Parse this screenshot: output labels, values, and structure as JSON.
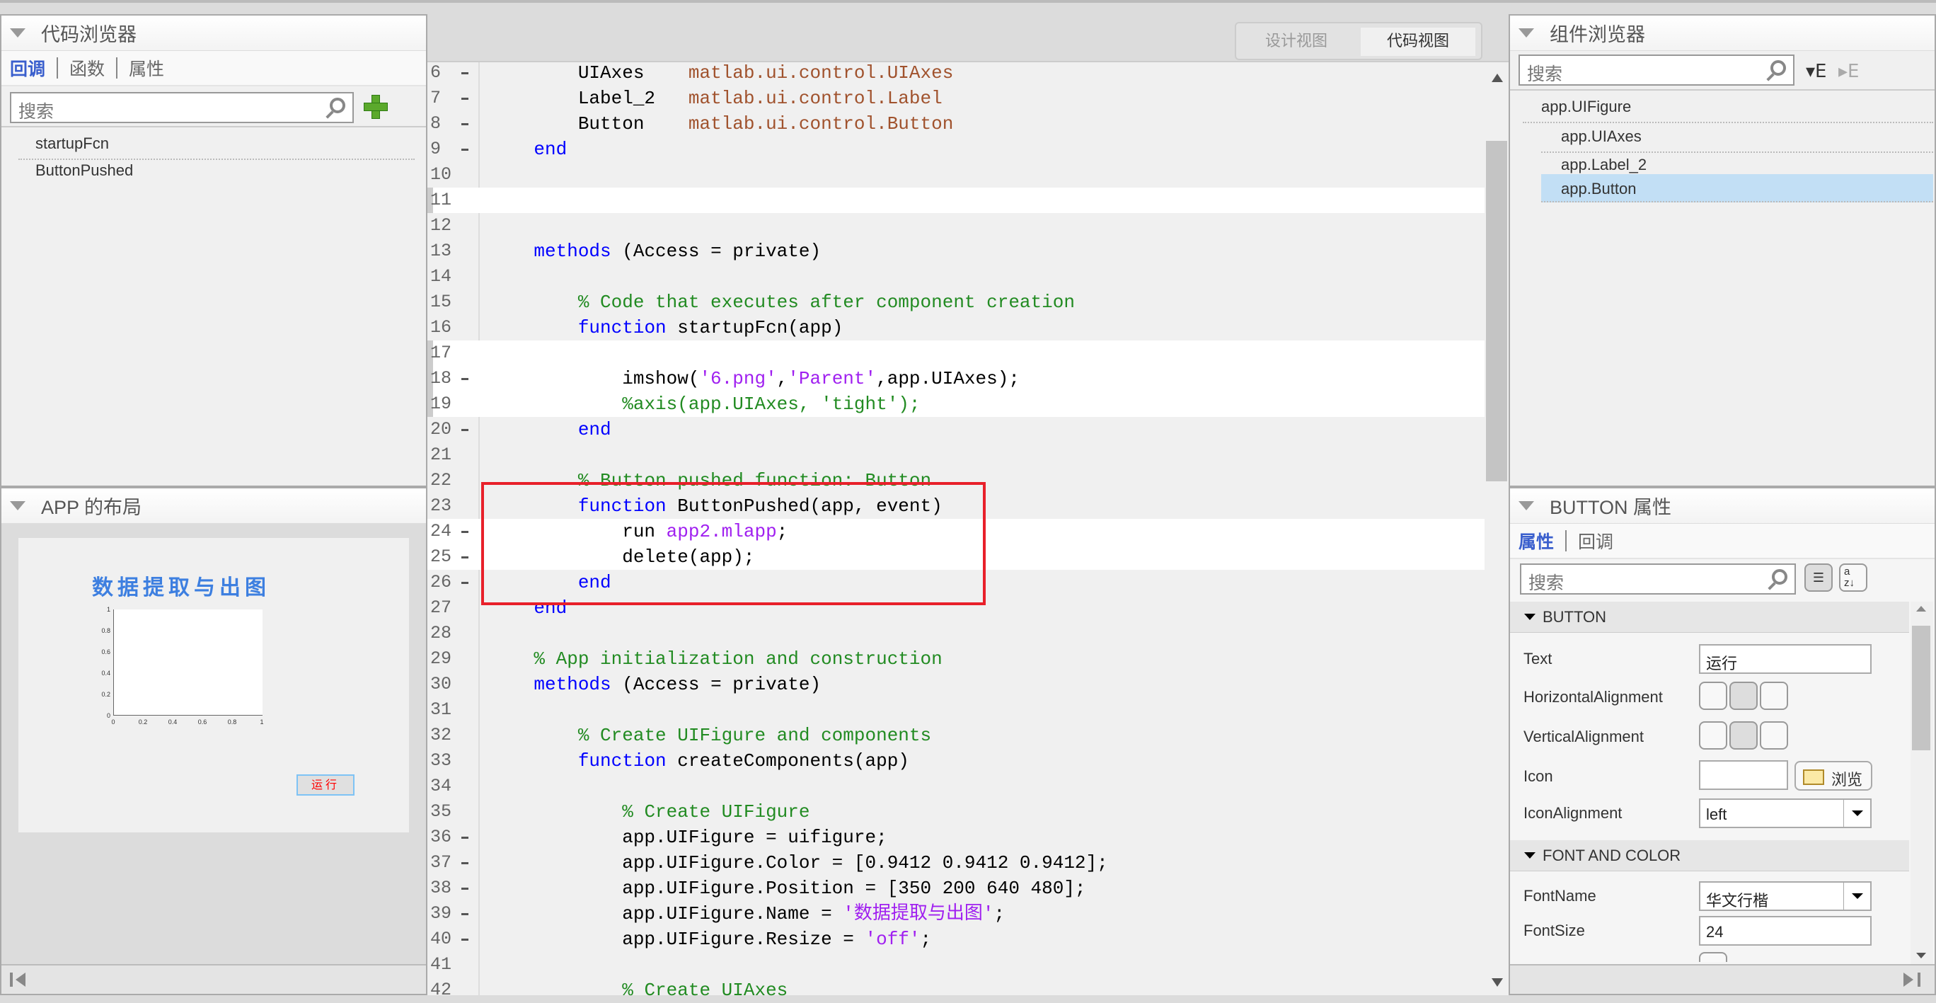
{
  "code_browser": {
    "title": "代码浏览器",
    "tabs": [
      "回调",
      "函数",
      "属性"
    ],
    "search_placeholder": "搜索",
    "items": [
      "startupFcn",
      "ButtonPushed"
    ]
  },
  "app_layout": {
    "title": "APP 的布局",
    "preview": {
      "title": "数据提取与出图",
      "button": "运行",
      "y_ticks": [
        "1",
        "0.8",
        "0.6",
        "0.4",
        "0.2",
        "0"
      ],
      "x_ticks": [
        "0",
        "0.2",
        "0.4",
        "0.6",
        "0.8",
        "1"
      ]
    }
  },
  "view_toggle": {
    "design": "设计视图",
    "code": "代码视图",
    "active": "code"
  },
  "editor": {
    "lines": [
      {
        "n": 6,
        "dash": true,
        "tokens": [
          [
            "n",
            "        UIAxes    "
          ],
          [
            "t",
            "matlab.ui.control.UIAxes"
          ]
        ]
      },
      {
        "n": 7,
        "dash": true,
        "tokens": [
          [
            "n",
            "        Label_2   "
          ],
          [
            "t",
            "matlab.ui.control.Label"
          ]
        ]
      },
      {
        "n": 8,
        "dash": true,
        "tokens": [
          [
            "n",
            "        Button    "
          ],
          [
            "t",
            "matlab.ui.control.Button"
          ]
        ]
      },
      {
        "n": 9,
        "dash": true,
        "tokens": [
          [
            "n",
            "    "
          ],
          [
            "k",
            "end"
          ]
        ]
      },
      {
        "n": 10,
        "tokens": []
      },
      {
        "n": 11,
        "hl": true,
        "bar": true,
        "tokens": []
      },
      {
        "n": 12,
        "tokens": []
      },
      {
        "n": 13,
        "tokens": [
          [
            "n",
            "    "
          ],
          [
            "k",
            "methods"
          ],
          [
            "n",
            " (Access = private)"
          ]
        ]
      },
      {
        "n": 14,
        "tokens": []
      },
      {
        "n": 15,
        "tokens": [
          [
            "n",
            "        "
          ],
          [
            "c",
            "% Code that executes after component creation"
          ]
        ]
      },
      {
        "n": 16,
        "tokens": [
          [
            "n",
            "        "
          ],
          [
            "k",
            "function"
          ],
          [
            "n",
            " startupFcn(app)"
          ]
        ]
      },
      {
        "n": 17,
        "hl": true,
        "bar": true,
        "tokens": []
      },
      {
        "n": 18,
        "dash": true,
        "hl": true,
        "bar": true,
        "tokens": [
          [
            "n",
            "            imshow("
          ],
          [
            "s",
            "'6.png'"
          ],
          [
            "n",
            ","
          ],
          [
            "s",
            "'Parent'"
          ],
          [
            "n",
            ",app.UIAxes);"
          ]
        ]
      },
      {
        "n": 19,
        "hl": true,
        "bar": true,
        "tokens": [
          [
            "n",
            "            "
          ],
          [
            "c",
            "%axis(app.UIAxes, 'tight');"
          ]
        ]
      },
      {
        "n": 20,
        "dash": true,
        "tokens": [
          [
            "n",
            "        "
          ],
          [
            "k",
            "end"
          ]
        ]
      },
      {
        "n": 21,
        "tokens": []
      },
      {
        "n": 22,
        "tokens": [
          [
            "n",
            "        "
          ],
          [
            "c",
            "% Button pushed function: Button"
          ]
        ]
      },
      {
        "n": 23,
        "tokens": [
          [
            "n",
            "        "
          ],
          [
            "k",
            "function"
          ],
          [
            "n",
            " ButtonPushed(app, event)"
          ]
        ]
      },
      {
        "n": 24,
        "dash": true,
        "hl": true,
        "tokens": [
          [
            "n",
            "            run "
          ],
          [
            "s",
            "app2.mlapp"
          ],
          [
            "n",
            ";"
          ]
        ]
      },
      {
        "n": 25,
        "dash": true,
        "hl": true,
        "tokens": [
          [
            "n",
            "            delete(app);"
          ]
        ]
      },
      {
        "n": 26,
        "dash": true,
        "tokens": [
          [
            "n",
            "        "
          ],
          [
            "k",
            "end"
          ]
        ]
      },
      {
        "n": 27,
        "tokens": [
          [
            "n",
            "    "
          ],
          [
            "k",
            "end"
          ]
        ]
      },
      {
        "n": 28,
        "tokens": []
      },
      {
        "n": 29,
        "tokens": [
          [
            "n",
            "    "
          ],
          [
            "c",
            "% App initialization and construction"
          ]
        ]
      },
      {
        "n": 30,
        "tokens": [
          [
            "n",
            "    "
          ],
          [
            "k",
            "methods"
          ],
          [
            "n",
            " (Access = private)"
          ]
        ]
      },
      {
        "n": 31,
        "tokens": []
      },
      {
        "n": 32,
        "tokens": [
          [
            "n",
            "        "
          ],
          [
            "c",
            "% Create UIFigure and components"
          ]
        ]
      },
      {
        "n": 33,
        "tokens": [
          [
            "n",
            "        "
          ],
          [
            "k",
            "function"
          ],
          [
            "n",
            " createComponents(app)"
          ]
        ]
      },
      {
        "n": 34,
        "tokens": []
      },
      {
        "n": 35,
        "tokens": [
          [
            "n",
            "            "
          ],
          [
            "c",
            "% Create UIFigure"
          ]
        ]
      },
      {
        "n": 36,
        "dash": true,
        "tokens": [
          [
            "n",
            "            app.UIFigure = uifigure;"
          ]
        ]
      },
      {
        "n": 37,
        "dash": true,
        "tokens": [
          [
            "n",
            "            app.UIFigure.Color = [0.9412 0.9412 0.9412];"
          ]
        ]
      },
      {
        "n": 38,
        "dash": true,
        "tokens": [
          [
            "n",
            "            app.UIFigure.Position = [350 200 640 480];"
          ]
        ]
      },
      {
        "n": 39,
        "dash": true,
        "tokens": [
          [
            "n",
            "            app.UIFigure.Name = "
          ],
          [
            "s",
            "'数据提取与出图'"
          ],
          [
            "n",
            ";"
          ]
        ]
      },
      {
        "n": 40,
        "dash": true,
        "tokens": [
          [
            "n",
            "            app.UIFigure.Resize = "
          ],
          [
            "s",
            "'off'"
          ],
          [
            "n",
            ";"
          ]
        ]
      },
      {
        "n": 41,
        "tokens": []
      },
      {
        "n": 42,
        "tokens": [
          [
            "n",
            "            "
          ],
          [
            "c",
            "% Create UIAxes"
          ]
        ]
      }
    ]
  },
  "component_browser": {
    "title": "组件浏览器",
    "search_placeholder": "搜索",
    "items": [
      "app.UIFigure",
      "app.UIAxes",
      "app.Label_2",
      "app.Button"
    ],
    "selected": "app.Button"
  },
  "inspector": {
    "title": "BUTTON 属性",
    "tabs": [
      "属性",
      "回调"
    ],
    "search_placeholder": "搜索",
    "sections": {
      "button": "BUTTON",
      "font": "FONT AND COLOR"
    },
    "labels": {
      "text": "Text",
      "halign": "HorizontalAlignment",
      "valign": "VerticalAlignment",
      "icon": "Icon",
      "iconalign": "IconAlignment",
      "fontname": "FontName",
      "fontsize": "FontSize"
    },
    "values": {
      "text": "运行",
      "icon": "",
      "browse": "浏览",
      "iconalign": "left",
      "fontname": "华文行楷",
      "fontsize": "24",
      "halign": "center",
      "valign": "center"
    }
  },
  "colors": {
    "keyword": "#0000ff",
    "string": "#a020f0",
    "comment": "#228b22",
    "type": "#a0522d",
    "highlight_box": "#e8202a",
    "selection": "#c2dff5"
  }
}
